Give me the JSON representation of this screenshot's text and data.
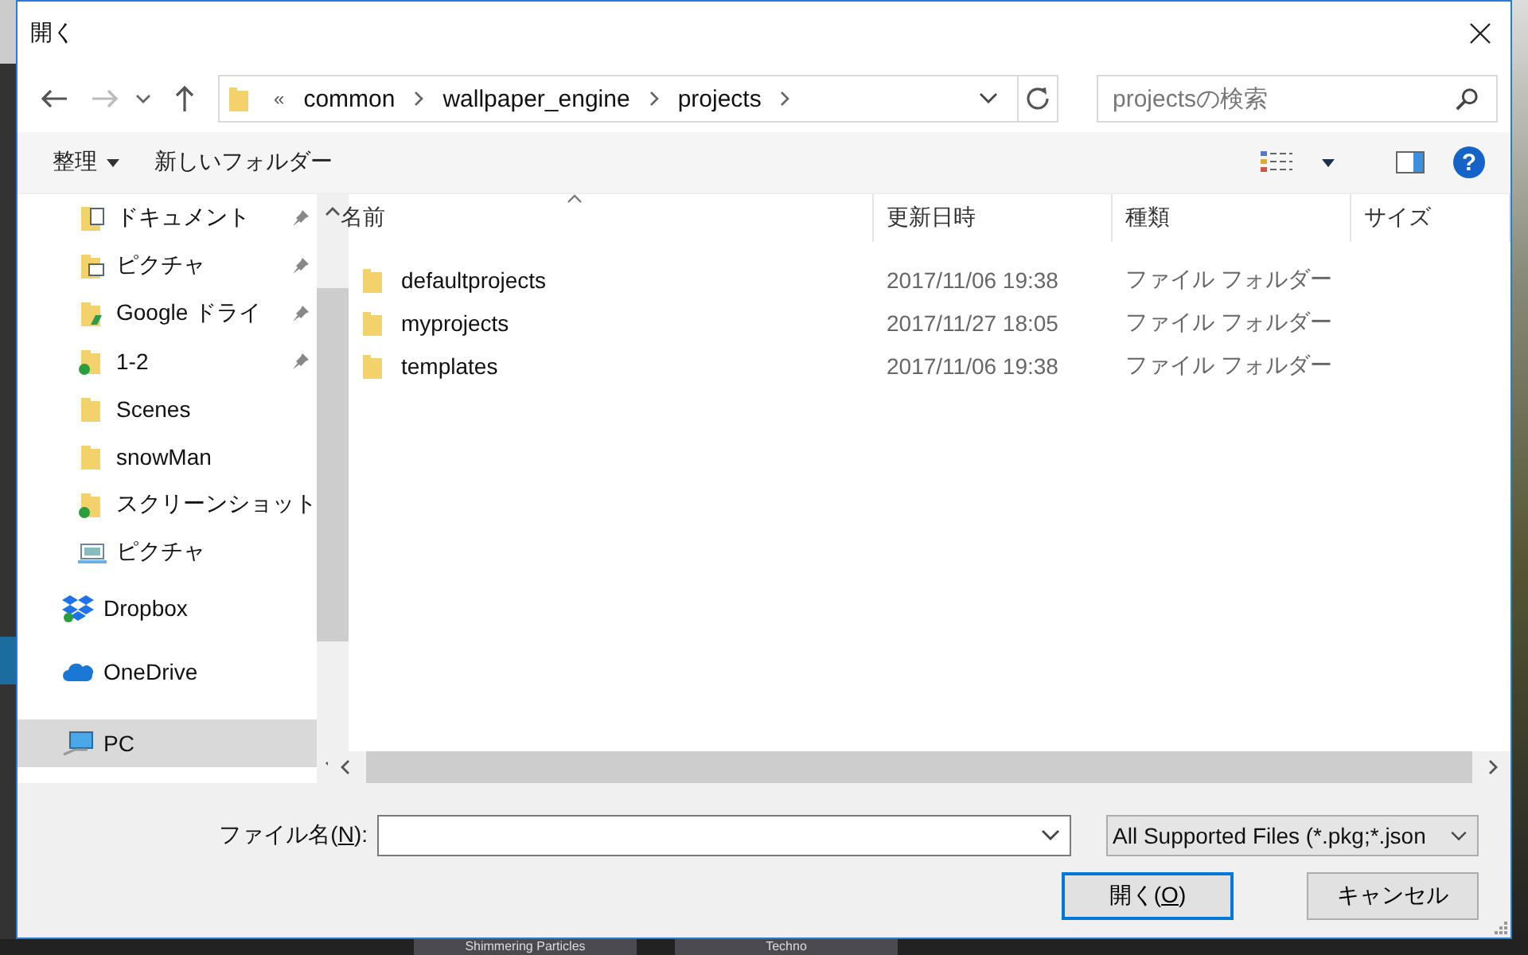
{
  "window": {
    "title": "開く"
  },
  "address_bar": {
    "overflow": "«",
    "segments": [
      "common",
      "wallpaper_engine",
      "projects"
    ]
  },
  "search": {
    "placeholder": "projectsの検索"
  },
  "toolbar": {
    "organize": "整理",
    "new_folder": "新しいフォルダー",
    "help": "?"
  },
  "quick_access_items": [
    {
      "label": "ドキュメント",
      "kind": "documents",
      "pinned": true,
      "selected": false
    },
    {
      "label": "ピクチャ",
      "kind": "pictures",
      "pinned": true,
      "selected": false
    },
    {
      "label": "Google ドライ",
      "kind": "gdrive",
      "pinned": true,
      "selected": false
    },
    {
      "label": "1-2",
      "kind": "synced",
      "pinned": true,
      "selected": false
    },
    {
      "label": "Scenes",
      "kind": "folder",
      "pinned": false,
      "selected": false
    },
    {
      "label": "snowMan",
      "kind": "folder",
      "pinned": false,
      "selected": false
    },
    {
      "label": "スクリーンショット",
      "kind": "synced",
      "pinned": false,
      "selected": false
    },
    {
      "label": "ピクチャ",
      "kind": "desktop",
      "pinned": false,
      "selected": false
    }
  ],
  "locations": [
    {
      "label": "Dropbox",
      "kind": "dropbox",
      "selected": false
    },
    {
      "label": "OneDrive",
      "kind": "onedrive",
      "selected": false
    },
    {
      "label": "PC",
      "kind": "pc",
      "selected": true
    }
  ],
  "table": {
    "columns": [
      "名前",
      "更新日時",
      "種類",
      "サイズ"
    ],
    "rows": [
      {
        "name": "defaultprojects",
        "modified": "2017/11/06 19:38",
        "type": "ファイル フォルダー"
      },
      {
        "name": "myprojects",
        "modified": "2017/11/27 18:05",
        "type": "ファイル フォルダー"
      },
      {
        "name": "templates",
        "modified": "2017/11/06 19:38",
        "type": "ファイル フォルダー"
      }
    ]
  },
  "file_name": {
    "prefix": "ファイル名(",
    "access_key": "N",
    "suffix": "):"
  },
  "file_type": "All Supported Files (*.pkg;*.json",
  "buttons": [
    {
      "kind": "open",
      "prefix": "開く(",
      "access_key": "O",
      "suffix": ")"
    },
    {
      "kind": "cancel",
      "prefix": "キャンセル"
    }
  ],
  "background_tiles": [
    "Shimmering Particles",
    "Techno"
  ]
}
